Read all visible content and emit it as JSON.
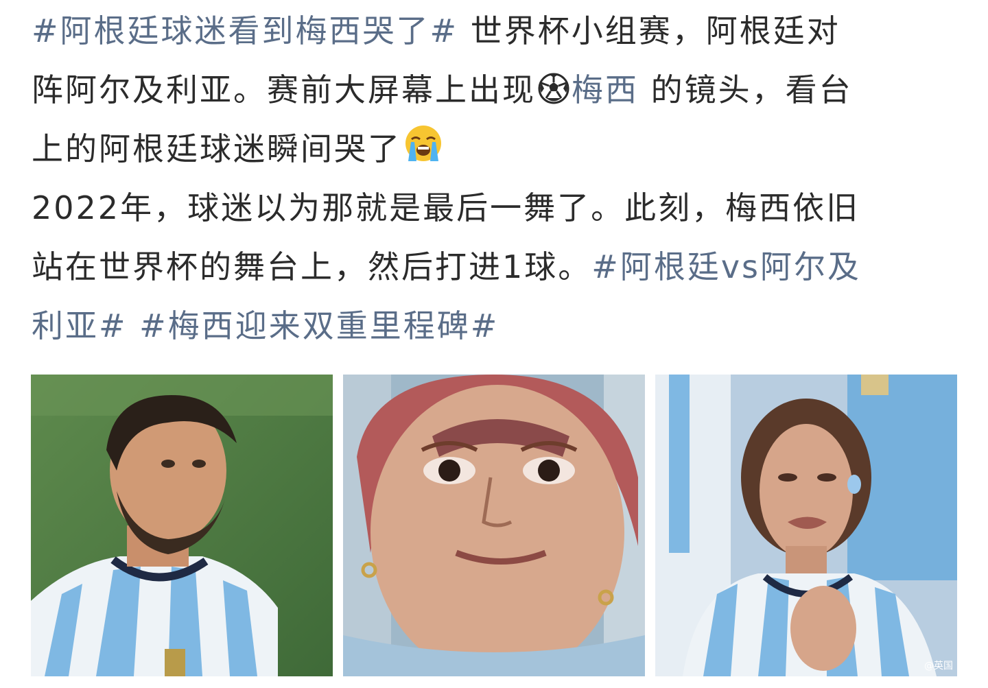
{
  "post": {
    "line1": {
      "tag1": "#阿根廷球迷看到梅西哭了#",
      "text": " 世界杯小组赛，阿根廷对"
    },
    "line2": {
      "text": "阵阿尔及利亚。赛前大屏幕上出现",
      "icon": "soccer-ball-icon",
      "mention": "梅西",
      "text2": " 的镜头，看台"
    },
    "line3": {
      "text": "上的阿根廷球迷瞬间哭了",
      "emoji": "crying-face-emoji"
    },
    "line4": {
      "text": "2022年，球迷以为那就是最后一舞了。此刻，梅西依旧"
    },
    "line5": {
      "text": "站在世界杯的舞台上，然后打进1球。",
      "tag2a": "#阿根廷vs阿尔及"
    },
    "line6": {
      "tag2b": "利亚#",
      "space": " ",
      "tag3": "#梅西迎来双重里程碑#"
    }
  },
  "images": [
    {
      "name": "player-photo"
    },
    {
      "name": "fan-photo-1"
    },
    {
      "name": "fan-photo-2",
      "watermark": "@英国"
    }
  ],
  "colors": {
    "text": "#2b2b2b",
    "link": "#5a6d88",
    "background": "#ffffff"
  }
}
